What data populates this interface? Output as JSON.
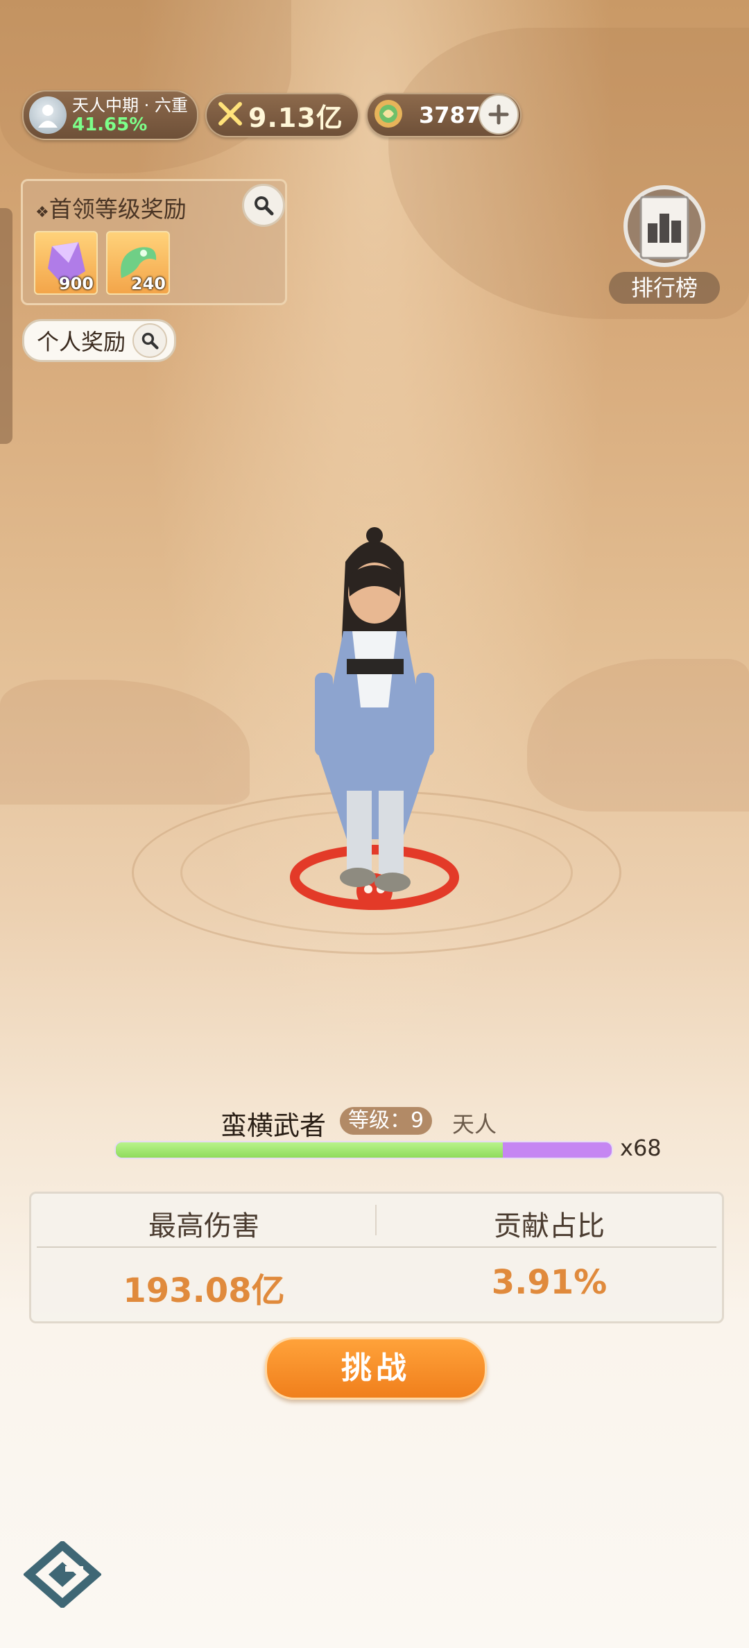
{
  "player": {
    "realm": "天人中期 · 六重",
    "realm_progress": "41.65%",
    "combat_power": "9.13亿",
    "currency": "3787"
  },
  "boss_rewards": {
    "title": "首领等级奖励",
    "items": [
      {
        "name": "purple-crystal-icon",
        "count": "900"
      },
      {
        "name": "green-jade-icon",
        "count": "240"
      }
    ]
  },
  "personal_reward": {
    "label": "个人奖励"
  },
  "ranking": {
    "label": "排行榜"
  },
  "boss": {
    "name": "蛮横武者",
    "level_label": "等级：9",
    "realm": "天人",
    "hp_multiplier": "x68",
    "hp_progress": 0.78
  },
  "stats": {
    "max_damage_label": "最高伤害",
    "max_damage_value": "193.08亿",
    "contribution_label": "贡献占比",
    "contribution_value": "3.91%"
  },
  "challenge": {
    "label": "挑战"
  },
  "colors": {
    "accent_orange": "#f07f1c",
    "value_orange": "#e08a3c",
    "hp_green": "#9fe36c",
    "hp_purple": "#c586f2"
  }
}
